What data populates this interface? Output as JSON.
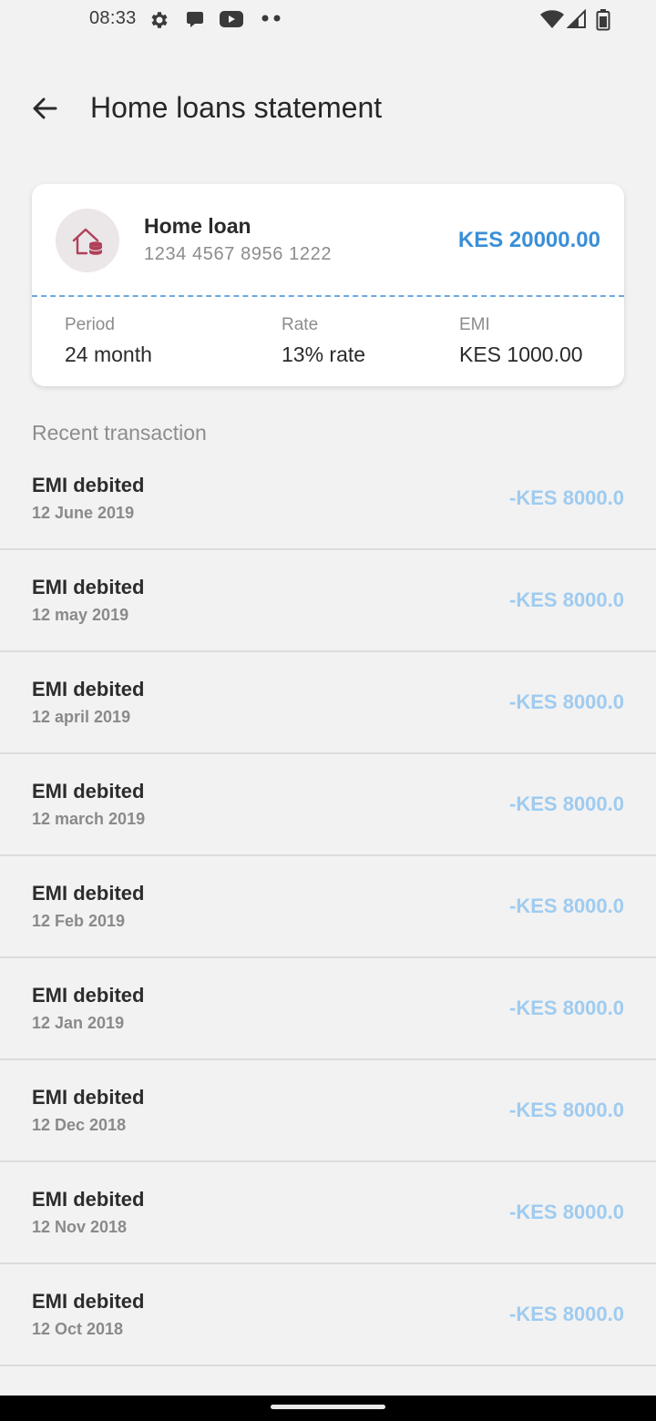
{
  "status_bar": {
    "time": "08:33",
    "icons": [
      "gear-icon",
      "chat-bubble-icon",
      "youtube-icon",
      "more-dots-icon",
      "wifi-icon",
      "signal-icon",
      "battery-icon"
    ]
  },
  "header": {
    "title": "Home loans statement",
    "back_icon": "arrow-left-icon"
  },
  "loan_card": {
    "icon": "home-loan-icon",
    "name": "Home loan",
    "account_number": "1234 4567 8956 1222",
    "amount": "KES 20000.00",
    "period_label": "Period",
    "period_value": "24 month",
    "rate_label": "Rate",
    "rate_value": "13% rate",
    "emi_label": "EMI",
    "emi_value": "KES 1000.00"
  },
  "transactions": {
    "section_title": "Recent transaction",
    "items": [
      {
        "title": "EMI debited",
        "date": "12 June 2019",
        "amount": "-KES 8000.0"
      },
      {
        "title": "EMI debited",
        "date": "12 may 2019",
        "amount": "-KES 8000.0"
      },
      {
        "title": "EMI debited",
        "date": "12 april 2019",
        "amount": "-KES 8000.0"
      },
      {
        "title": "EMI debited",
        "date": "12 march 2019",
        "amount": "-KES 8000.0"
      },
      {
        "title": "EMI debited",
        "date": "12 Feb 2019",
        "amount": "-KES 8000.0"
      },
      {
        "title": "EMI debited",
        "date": "12 Jan 2019",
        "amount": "-KES 8000.0"
      },
      {
        "title": "EMI debited",
        "date": "12 Dec 2018",
        "amount": "-KES 8000.0"
      },
      {
        "title": "EMI debited",
        "date": "12 Nov 2018",
        "amount": "-KES 8000.0"
      },
      {
        "title": "EMI debited",
        "date": "12 Oct 2018",
        "amount": "-KES 8000.0"
      }
    ]
  },
  "colors": {
    "accent": "#3a8fd6",
    "debit_amount": "#9fcbf0",
    "loan_icon": "#b0405a",
    "background": "#f2f2f2"
  }
}
